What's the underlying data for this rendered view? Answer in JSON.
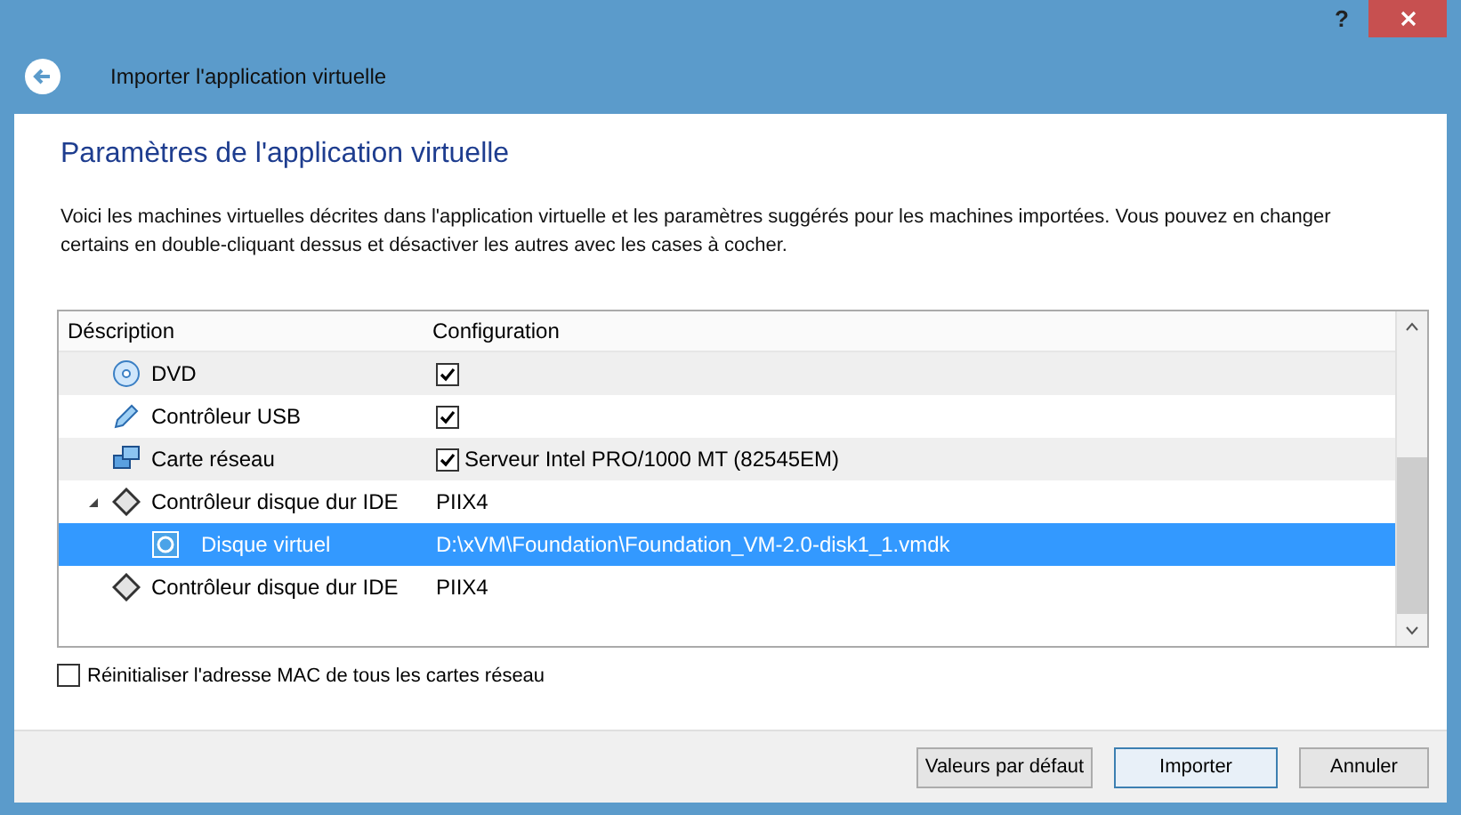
{
  "window": {
    "title": "Importer l'application virtuelle",
    "help_button": "?"
  },
  "page": {
    "heading": "Paramètres de l'application virtuelle",
    "description": "Voici les machines virtuelles décrites dans l'application virtuelle et les paramètres suggérés pour les machines importées. Vous pouvez en changer certains en double-cliquant dessus et désactiver les autres avec les cases à cocher."
  },
  "table": {
    "columns": [
      "Déscription",
      "Configuration"
    ],
    "rows": [
      {
        "kind": "dvd",
        "label": "DVD",
        "checked": true,
        "selected": false
      },
      {
        "kind": "usb",
        "label": "Contrôleur USB",
        "checked": true,
        "selected": false
      },
      {
        "kind": "network",
        "label": "Carte réseau",
        "checked": true,
        "value": "Serveur Intel PRO/1000 MT (82545EM)",
        "selected": false
      },
      {
        "kind": "controller",
        "label": "Contrôleur disque dur IDE",
        "value": "PIIX4",
        "selected": false,
        "expanded": true,
        "children": [
          {
            "kind": "disk",
            "label": "Disque virtuel",
            "value": "D:\\xVM\\Foundation\\Foundation_VM-2.0-disk1_1.vmdk",
            "selected": true
          }
        ]
      },
      {
        "kind": "controller",
        "label": "Contrôleur disque dur IDE",
        "value": "PIIX4",
        "selected": false
      }
    ]
  },
  "reset_mac": {
    "label": "Réinitialiser l'adresse MAC de tous les cartes réseau",
    "checked": false
  },
  "buttons": [
    {
      "label": "Valeurs par défaut",
      "default": false
    },
    {
      "label": "Importer",
      "default": true
    },
    {
      "label": "Annuler",
      "default": false
    }
  ]
}
